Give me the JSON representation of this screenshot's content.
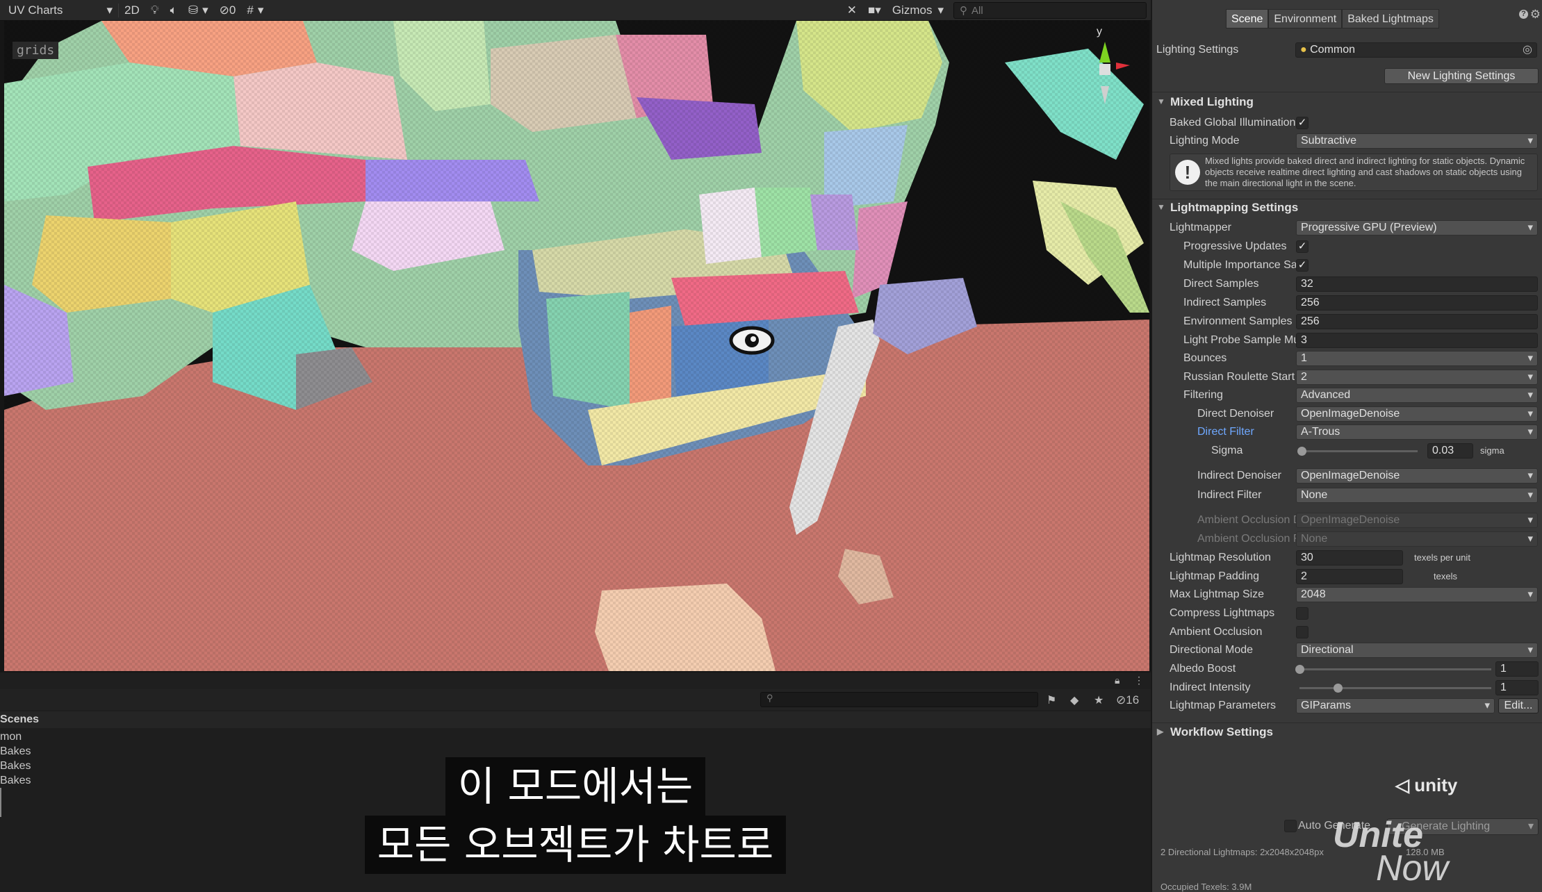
{
  "scene": {
    "draw_mode": "UV Charts",
    "btn_2d": "2D",
    "hidden_count": "0",
    "gizmos": "Gizmos",
    "search_placeholder": "All",
    "grids_tag": "grids",
    "gizmo_axis": "y"
  },
  "bottom": {
    "hidden_count": "16",
    "scenes_header": "Scenes",
    "scenes": [
      "mon",
      "Bakes",
      "Bakes",
      "Bakes",
      "",
      ""
    ]
  },
  "subtitle": {
    "line1": "이 모드에서는",
    "line2": "모든 오브젝트가 차트로"
  },
  "panel": {
    "tabs": [
      "Scene",
      "Environment",
      "Baked Lightmaps"
    ],
    "lighting_settings_label": "Lighting Settings",
    "lighting_settings_value": "Common",
    "new_lighting_button": "New Lighting Settings",
    "mixed_lighting": {
      "title": "Mixed Lighting",
      "baked_gi_label": "Baked Global Illumination",
      "baked_gi_checked": "✓",
      "lighting_mode_label": "Lighting Mode",
      "lighting_mode_value": "Subtractive",
      "info_text": "Mixed lights provide baked direct and indirect lighting for static objects. Dynamic objects receive realtime direct lighting and cast shadows on static objects using the main directional light in the scene."
    },
    "lightmapping": {
      "title": "Lightmapping Settings",
      "lightmapper_label": "Lightmapper",
      "lightmapper_value": "Progressive GPU (Preview)",
      "progressive_updates_label": "Progressive Updates",
      "progressive_updates_checked": "✓",
      "multiple_importance_label": "Multiple Importance Sampling",
      "multiple_importance_checked": "✓",
      "direct_samples_label": "Direct Samples",
      "direct_samples_value": "32",
      "indirect_samples_label": "Indirect Samples",
      "indirect_samples_value": "256",
      "environment_samples_label": "Environment Samples",
      "environment_samples_value": "256",
      "light_probe_label": "Light Probe Sample Multiplier",
      "light_probe_value": "3",
      "bounces_label": "Bounces",
      "bounces_value": "1",
      "russian_roulette_label": "Russian Roulette Start Bounce",
      "russian_roulette_value": "2",
      "filtering_label": "Filtering",
      "filtering_value": "Advanced",
      "direct_denoiser_label": "Direct Denoiser",
      "direct_denoiser_value": "OpenImageDenoise",
      "direct_filter_label": "Direct Filter",
      "direct_filter_value": "A-Trous",
      "sigma_label": "Sigma",
      "sigma_value": "0.03",
      "sigma_fraction": 0.02,
      "sigma_unit": "sigma",
      "indirect_denoiser_label": "Indirect Denoiser",
      "indirect_denoiser_value": "OpenImageDenoise",
      "indirect_filter_label": "Indirect Filter",
      "indirect_filter_value": "None",
      "ao_denoiser_label": "Ambient Occlusion Denoiser",
      "ao_denoiser_value": "OpenImageDenoise",
      "ao_filter_label": "Ambient Occlusion Filter",
      "ao_filter_value": "None",
      "lightmap_resolution_label": "Lightmap Resolution",
      "lightmap_resolution_value": "30",
      "lightmap_resolution_unit": "texels per unit",
      "lightmap_padding_label": "Lightmap Padding",
      "lightmap_padding_value": "2",
      "lightmap_padding_unit": "texels",
      "max_lightmap_label": "Max Lightmap Size",
      "max_lightmap_value": "2048",
      "compress_label": "Compress Lightmaps",
      "ambient_occlusion_label": "Ambient Occlusion",
      "directional_mode_label": "Directional Mode",
      "directional_mode_value": "Directional",
      "albedo_boost_label": "Albedo Boost",
      "albedo_boost_value": "1",
      "albedo_boost_fraction": 0.0,
      "indirect_intensity_label": "Indirect Intensity",
      "indirect_intensity_value": "1",
      "indirect_intensity_fraction": 0.2,
      "lightmap_params_label": "Lightmap Parameters",
      "lightmap_params_value": "GIParams",
      "edit_button": "Edit..."
    },
    "workflow_title": "Workflow Settings",
    "unity_logo": "unity",
    "unite_logo_1": "Unite",
    "unite_logo_2": "Now",
    "auto_generate_label": "Auto Generate",
    "generate_button": "Generate Lighting",
    "stats_line1": "2 Directional Lightmaps: 2x2048x2048px",
    "stats_line1_size": "128.0 MB",
    "stats_line2": "Occupied Texels: 3.9M"
  },
  "colors": {
    "ground": "#c9776e",
    "background": "#121212",
    "panel_bg": "#383838",
    "link_blue": "#6fa8ff"
  }
}
